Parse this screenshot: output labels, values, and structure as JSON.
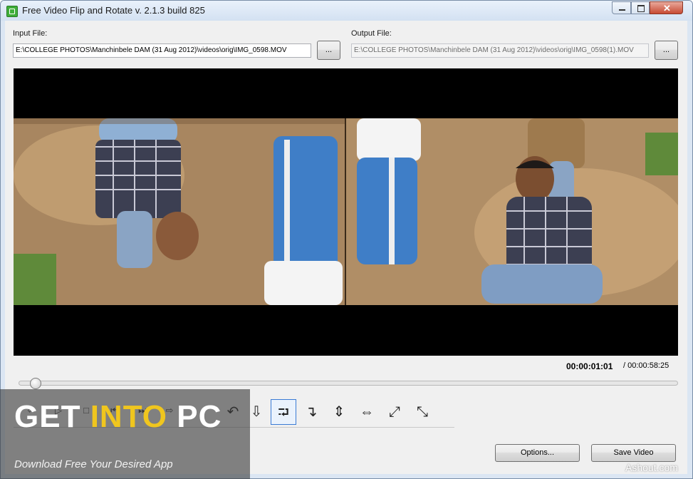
{
  "window": {
    "title": "Free Video Flip and Rotate  v. 2.1.3 build 825"
  },
  "input": {
    "label": "Input File:",
    "value": "E:\\COLLEGE PHOTOS\\Manchinbele DAM (31 Aug 2012)\\videos\\orig\\IMG_0598.MOV",
    "browse": "..."
  },
  "output": {
    "label": "Output File:",
    "value": "E:\\COLLEGE PHOTOS\\Manchinbele DAM (31 Aug 2012)\\videos\\orig\\IMG_0598(1).MOV",
    "browse": "..."
  },
  "playback": {
    "current_time": "00:00:01:01",
    "total_time": "/ 00:00:58:25",
    "position_fraction": 0.017
  },
  "controls": [
    {
      "name": "step-back-icon",
      "glyph": "⇦"
    },
    {
      "name": "play-icon",
      "glyph": "▷"
    },
    {
      "name": "stop-icon",
      "glyph": "□"
    },
    {
      "name": "prev-frame-icon",
      "glyph": "⏮"
    },
    {
      "name": "next-frame-icon",
      "glyph": "⏭"
    },
    {
      "name": "step-forward-icon",
      "glyph": "⇨"
    }
  ],
  "tools": [
    {
      "name": "rotate-left-icon",
      "glyph": "↶",
      "selected": false
    },
    {
      "name": "rotate-180-icon",
      "glyph": "⇩",
      "selected": false
    },
    {
      "name": "rotate-right-icon",
      "glyph": "⮒",
      "selected": true
    },
    {
      "name": "rotate-down-icon",
      "glyph": "↴",
      "selected": false
    },
    {
      "name": "flip-vertical-icon",
      "glyph": "⇕",
      "selected": false
    },
    {
      "name": "flip-horizontal-icon",
      "glyph": "⇔",
      "selected": false
    },
    {
      "name": "transpose-icon",
      "glyph": "⤢",
      "selected": false
    },
    {
      "name": "transverse-icon",
      "glyph": "⤡",
      "selected": false
    }
  ],
  "buttons": {
    "options": "Options...",
    "save": "Save Video"
  },
  "watermark": {
    "get": "GET ",
    "into": "INTO",
    "pc": " PC",
    "tagline": "Download Free Your Desired App",
    "site": "Ashout.com"
  },
  "colors": {
    "selection": "#3a7bd5",
    "watermark_accent": "#f0c61e"
  }
}
